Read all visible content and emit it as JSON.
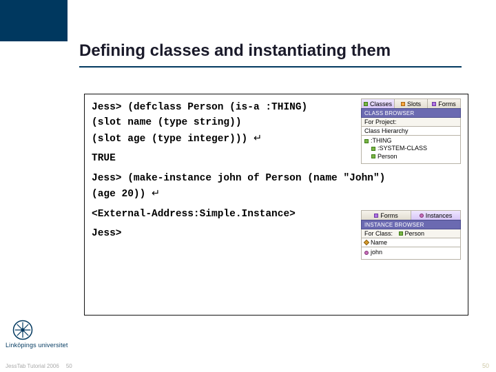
{
  "title": "Defining classes and instantiating them",
  "code": {
    "l1": "Jess> (defclass Person (is-a :THING)",
    "l2": "(slot name (type string))",
    "l3": "(slot age (type integer))) ",
    "l4": "TRUE",
    "l5": "Jess> (make-instance john of Person (name \"John\")",
    "l6": "(age 20)) ",
    "l7": "<External-Address:Simple.Instance>",
    "l8": "Jess>",
    "enter": "↵"
  },
  "panel1": {
    "tabs": {
      "a": "Classes",
      "b": "Slots",
      "c": "Forms"
    },
    "browser": "CLASS BROWSER",
    "forProject": "For Project:",
    "hierarchy": "Class Hierarchy",
    "tree": {
      "root": ":THING",
      "child1": ":SYSTEM-CLASS",
      "child2": "Person"
    }
  },
  "panel2": {
    "tabs": {
      "a": "Forms",
      "b": "Instances"
    },
    "browser": "INSTANCE BROWSER",
    "forLabel": "For Class:",
    "forValue": "Person",
    "row2label": "Name",
    "instance": "john"
  },
  "footer": {
    "tutorial": "JessTab Tutorial 2006",
    "page_small": "50",
    "page_right": "50",
    "university": "Linköpings universitet"
  }
}
